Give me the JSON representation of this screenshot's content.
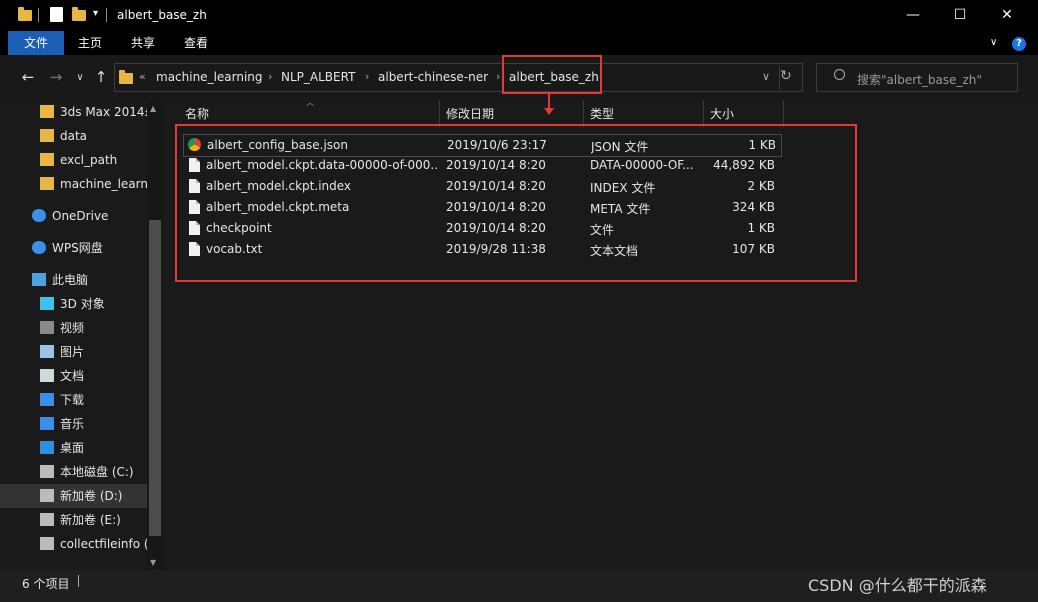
{
  "window": {
    "title": "albert_base_zh",
    "controls": [
      "—",
      "☐",
      "✕"
    ]
  },
  "ribbon": {
    "tabs": [
      "文件",
      "主页",
      "共享",
      "查看"
    ],
    "help": "?"
  },
  "address": {
    "overflow": "«",
    "crumbs": [
      "machine_learning",
      "NLP_ALBERT",
      "albert-chinese-ner",
      "albert_base_zh"
    ],
    "search_placeholder": "搜索\"albert_base_zh\""
  },
  "sidebar": {
    "items": [
      {
        "label": "3ds Max 2014£",
        "icon": "folder-icon"
      },
      {
        "label": "data",
        "icon": "folder-icon"
      },
      {
        "label": "excl_path",
        "icon": "folder-icon"
      },
      {
        "label": "machine_learni",
        "icon": "folder-icon"
      },
      {
        "label": "OneDrive",
        "icon": "cloud-icon"
      },
      {
        "label": "WPS网盘",
        "icon": "cloud-icon"
      },
      {
        "label": "此电脑",
        "icon": "computer-icon"
      },
      {
        "label": "3D 对象",
        "icon": "cube-icon"
      },
      {
        "label": "视频",
        "icon": "video-icon"
      },
      {
        "label": "图片",
        "icon": "picture-icon"
      },
      {
        "label": "文档",
        "icon": "document-icon"
      },
      {
        "label": "下载",
        "icon": "download-icon"
      },
      {
        "label": "音乐",
        "icon": "music-icon"
      },
      {
        "label": "桌面",
        "icon": "desktop-icon"
      },
      {
        "label": "本地磁盘 (C:)",
        "icon": "drive-icon"
      },
      {
        "label": "新加卷 (D:)",
        "icon": "drive-icon"
      },
      {
        "label": "新加卷 (E:)",
        "icon": "drive-icon"
      },
      {
        "label": "collectfileinfo (",
        "icon": "drive-icon"
      }
    ]
  },
  "columns": [
    "名称",
    "修改日期",
    "类型",
    "大小"
  ],
  "files": [
    {
      "name": "albert_config_base.json",
      "date": "2019/10/6 23:17",
      "type": "JSON 文件",
      "size": "1 KB",
      "icon": "chrome-icon"
    },
    {
      "name": "albert_model.ckpt.data-00000-of-000...",
      "date": "2019/10/14 8:20",
      "type": "DATA-00000-OF...",
      "size": "44,892 KB",
      "icon": "file-icon"
    },
    {
      "name": "albert_model.ckpt.index",
      "date": "2019/10/14 8:20",
      "type": "INDEX 文件",
      "size": "2 KB",
      "icon": "file-icon"
    },
    {
      "name": "albert_model.ckpt.meta",
      "date": "2019/10/14 8:20",
      "type": "META 文件",
      "size": "324 KB",
      "icon": "file-icon"
    },
    {
      "name": "checkpoint",
      "date": "2019/10/14 8:20",
      "type": "文件",
      "size": "1 KB",
      "icon": "file-icon"
    },
    {
      "name": "vocab.txt",
      "date": "2019/9/28 11:38",
      "type": "文本文档",
      "size": "107 KB",
      "icon": "file-icon"
    }
  ],
  "status": {
    "count": "6 个项目",
    "watermark": "CSDN @什么都干的派森"
  }
}
